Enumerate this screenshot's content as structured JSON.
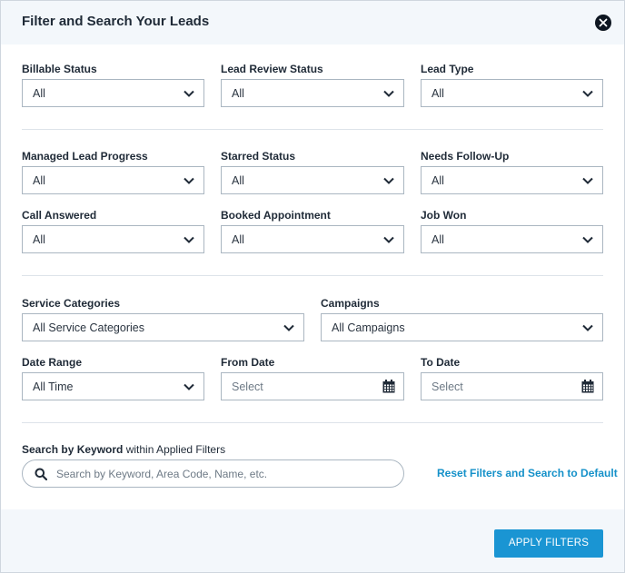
{
  "title": "Filter and Search Your Leads",
  "filters": {
    "billable_status": {
      "label": "Billable Status",
      "value": "All"
    },
    "lead_review_status": {
      "label": "Lead Review Status",
      "value": "All"
    },
    "lead_type": {
      "label": "Lead Type",
      "value": "All"
    },
    "managed_lead_progress": {
      "label": "Managed Lead Progress",
      "value": "All"
    },
    "starred_status": {
      "label": "Starred Status",
      "value": "All"
    },
    "needs_follow_up": {
      "label": "Needs Follow-Up",
      "value": "All"
    },
    "call_answered": {
      "label": "Call Answered",
      "value": "All"
    },
    "booked_appointment": {
      "label": "Booked Appointment",
      "value": "All"
    },
    "job_won": {
      "label": "Job Won",
      "value": "All"
    },
    "service_categories": {
      "label": "Service Categories",
      "value": "All Service Categories"
    },
    "campaigns": {
      "label": "Campaigns",
      "value": "All Campaigns"
    },
    "date_range": {
      "label": "Date Range",
      "value": "All Time"
    },
    "from_date": {
      "label": "From Date",
      "placeholder": "Select"
    },
    "to_date": {
      "label": "To Date",
      "placeholder": "Select"
    }
  },
  "search": {
    "label_bold": "Search by Keyword",
    "label_rest": " within Applied Filters",
    "placeholder": "Search by Keyword, Area Code, Name, etc."
  },
  "reset_label": "Reset Filters and Search to Default",
  "apply_label": "APPLY FILTERS",
  "icons": {
    "close": "close-icon",
    "chevron": "chevron-down-icon",
    "calendar": "calendar-icon",
    "search": "search-icon"
  },
  "colors": {
    "accent": "#1a95d3",
    "link": "#1591c9",
    "header_bg": "#f3f7fb",
    "text": "#1f2a37"
  }
}
